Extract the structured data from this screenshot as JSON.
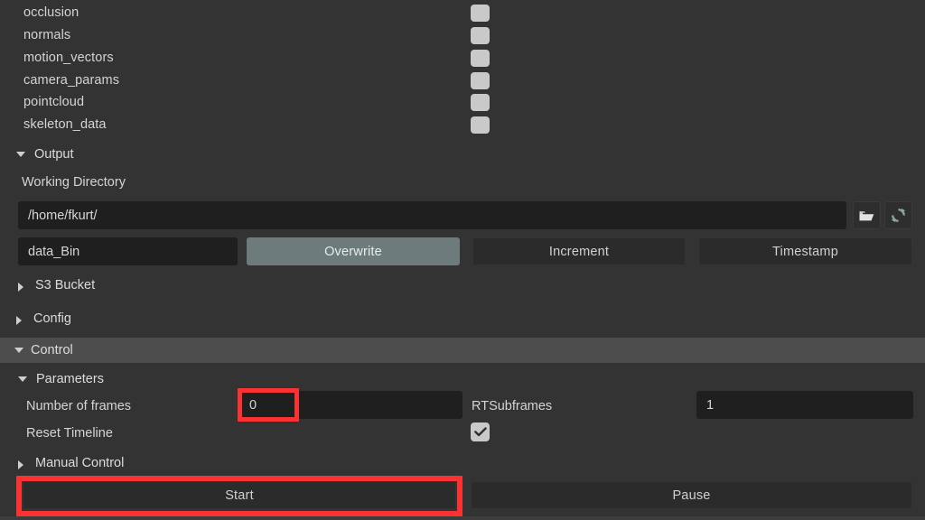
{
  "theme": {
    "background": "#333333",
    "header_bar": "#4d4d4d",
    "field_background": "#1f1f1f",
    "button_background": "#2b2b2b",
    "selected_button": "#6e7b7d",
    "text": "#d4d4d4",
    "annotation": "#fa3232",
    "checkbox": "#c9c9c9"
  },
  "outputs": {
    "items": [
      {
        "label": "occlusion",
        "checked": false
      },
      {
        "label": "normals",
        "checked": false
      },
      {
        "label": "motion_vectors",
        "checked": false
      },
      {
        "label": "camera_params",
        "checked": false
      },
      {
        "label": "pointcloud",
        "checked": false
      },
      {
        "label": "skeleton_data",
        "checked": false
      }
    ]
  },
  "output_section": {
    "title": "Output",
    "expanded": true,
    "working_directory_label": "Working Directory",
    "working_directory_value": "/home/fkurt/",
    "working_directory_placeholder": "/home/fkurt/",
    "browse_icon": "folder-icon",
    "refresh_icon": "refresh-icon",
    "filename_value": "data_Bin",
    "filename_placeholder": "data_Bin",
    "mode_buttons": [
      {
        "label": "Overwrite",
        "selected": true
      },
      {
        "label": "Increment",
        "selected": false
      },
      {
        "label": "Timestamp",
        "selected": false
      }
    ],
    "s3_bucket": {
      "title": "S3 Bucket",
      "expanded": false
    },
    "config": {
      "title": "Config",
      "expanded": false
    }
  },
  "control_section": {
    "title": "Control",
    "expanded": true,
    "parameters": {
      "title": "Parameters",
      "expanded": true,
      "number_of_frames_label": "Number of frames",
      "number_of_frames_value": "0",
      "rt_subframes_label": "RTSubframes",
      "rt_subframes_value": "1",
      "reset_timeline_label": "Reset Timeline",
      "reset_timeline_checked": true
    },
    "manual_control": {
      "title": "Manual Control",
      "expanded": false
    },
    "start_button": "Start",
    "pause_button": "Pause"
  },
  "annotations": [
    {
      "name": "number-of-frames-highlight",
      "target": "Number of frames value"
    },
    {
      "name": "start-button-highlight",
      "target": "Start button"
    }
  ]
}
